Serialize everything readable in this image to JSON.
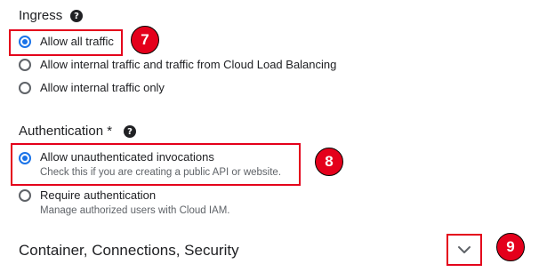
{
  "ingress": {
    "title": "Ingress",
    "help_icon": "?",
    "options": [
      {
        "label": "Allow all traffic",
        "selected": true
      },
      {
        "label": "Allow internal traffic and traffic from Cloud Load Balancing",
        "selected": false
      },
      {
        "label": "Allow internal traffic only",
        "selected": false
      }
    ]
  },
  "authentication": {
    "title": "Authentication *",
    "help_icon": "?",
    "options": [
      {
        "label": "Allow unauthenticated invocations",
        "help": "Check this if you are creating a public API or website.",
        "selected": true
      },
      {
        "label": "Require authentication",
        "help": "Manage authorized users with Cloud IAM.",
        "selected": false
      }
    ]
  },
  "accordion": {
    "title": "Container, Connections, Security",
    "icon": "chevron-down-icon"
  },
  "annotations": {
    "badges": [
      "7",
      "8",
      "9"
    ],
    "color": "#e4001b"
  },
  "colors": {
    "accent": "#1a73e8",
    "text": "#202124",
    "secondary_text": "#5f6368"
  }
}
